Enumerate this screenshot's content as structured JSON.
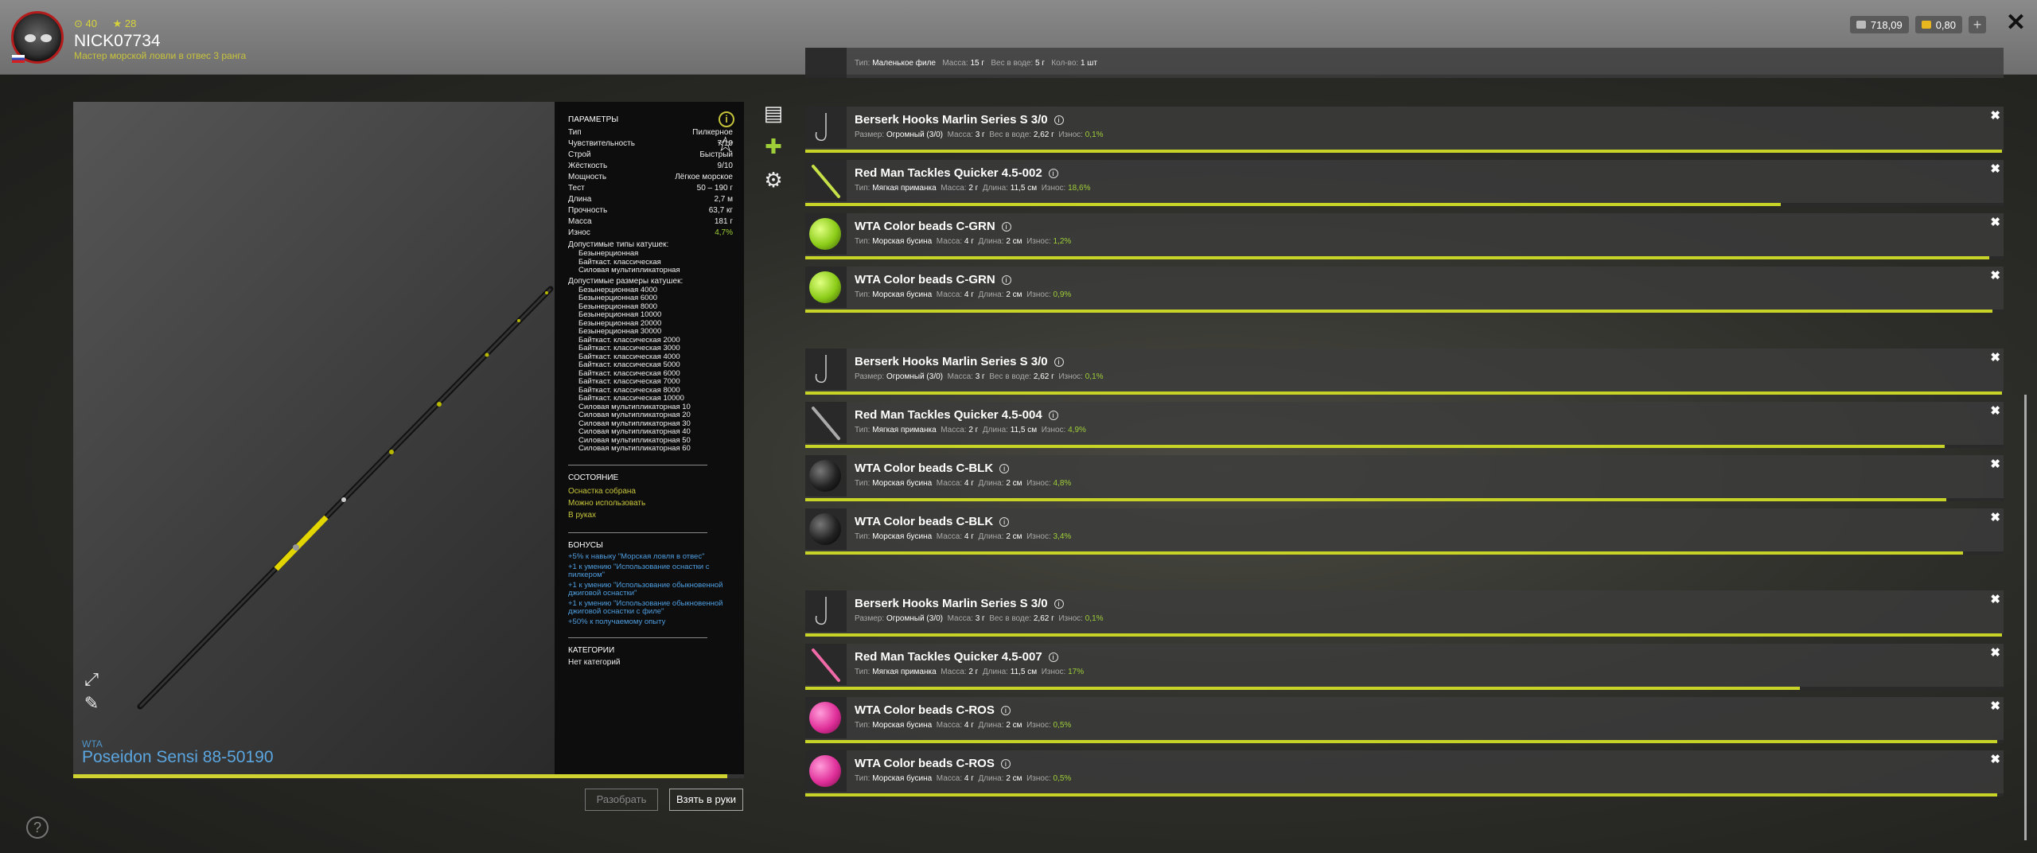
{
  "header": {
    "stats": [
      "40",
      "28"
    ],
    "nickname": "NICK07734",
    "rank": "Мастер морской ловли в отвес 3 ранга",
    "currency_silver": "718,09",
    "currency_gold": "0,80",
    "add_label": "+",
    "close_label": "✕"
  },
  "rod": {
    "brand": "WTA",
    "name": "Poseidon Sensi 88-50190",
    "progress": 0.975
  },
  "params": {
    "title": "ПАРАМЕТРЫ",
    "rows": [
      {
        "k": "Тип",
        "v": "Пилкерное"
      },
      {
        "k": "Чувствительность",
        "v": "7/10"
      },
      {
        "k": "Строй",
        "v": "Быстрый"
      },
      {
        "k": "Жёсткость",
        "v": "9/10"
      },
      {
        "k": "Мощность",
        "v": "Лёгкое морское"
      },
      {
        "k": "Тест",
        "v": "50 – 190 г"
      },
      {
        "k": "Длина",
        "v": "2,7 м"
      },
      {
        "k": "Прочность",
        "v": "63,7 кг"
      },
      {
        "k": "Масса",
        "v": "181 г"
      },
      {
        "k": "Износ",
        "v": "4,7%"
      }
    ],
    "reel_types_title": "Допустимые типы катушек:",
    "reel_types": [
      "Безынерционная",
      "Байткаст. классическая",
      "Силовая мультипликаторная"
    ],
    "reel_sizes_title": "Допустимые размеры катушек:",
    "reel_sizes": [
      "Безынерционная 4000",
      "Безынерционная 6000",
      "Безынерционная 8000",
      "Безынерционная 10000",
      "Безынерционная 20000",
      "Безынерционная 30000",
      "Байткаст. классическая 2000",
      "Байткаст. классическая 3000",
      "Байткаст. классическая 4000",
      "Байткаст. классическая 5000",
      "Байткаст. классическая 6000",
      "Байткаст. классическая 7000",
      "Байткаст. классическая 8000",
      "Байткаст. классическая 10000",
      "Силовая мультипликаторная 10",
      "Силовая мультипликаторная 20",
      "Силовая мультипликаторная 30",
      "Силовая мультипликаторная 40",
      "Силовая мультипликаторная 50",
      "Силовая мультипликаторная 60"
    ],
    "state_title": "СОСТОЯНИЕ",
    "state": [
      "Оснастка собрана",
      "Можно использовать",
      "В руках"
    ],
    "bonus_title": "БОНУСЫ",
    "bonuses": [
      "+5% к навыку \"Морская ловля в отвес\"",
      "+1 к умению \"Использование оснастки с пилкером\"",
      "+1 к умению \"Использование обыкновенной джиговой оснастки\"",
      "+1 к умению \"Использование обыкновенной джиговой оснастки с филе\"",
      "+50% к получаемому опыту"
    ],
    "cat_title": "КАТЕГОРИИ",
    "categories": "Нет категорий"
  },
  "buttons": {
    "disassemble": "Разобрать",
    "take": "Взять в руки"
  },
  "icons": {
    "info": "i",
    "help": "?"
  },
  "top_partial": {
    "type_label": "Тип:",
    "type": "Маленькое филе",
    "mass_label": "Масса:",
    "mass": "15 г",
    "water_label": "Вес в воде:",
    "water": "5 г",
    "count_label": "Кол-во:",
    "count": "1 шт"
  },
  "items": [
    {
      "name": "Berserk Hooks Marlin Series S 3/0",
      "kind": "hook",
      "f1": "Размер:",
      "v1": "Огромный (3/0)",
      "f2": "Масса:",
      "v2": "3 г",
      "f3": "Вес в воде:",
      "v3": "2,62 г",
      "wear_label": "Износ:",
      "wear": "0,1%",
      "bar": 0.999
    },
    {
      "name": "Red Man Tackles Quicker 4.5-002",
      "kind": "lure-green",
      "f1": "Тип:",
      "v1": "Мягкая приманка",
      "f2": "Масса:",
      "v2": "2 г",
      "f3": "Длина:",
      "v3": "11,5 см",
      "wear_label": "Износ:",
      "wear": "18,6%",
      "bar": 0.814
    },
    {
      "name": "WTA Color beads C-GRN",
      "kind": "grn",
      "f1": "Тип:",
      "v1": "Морская бусина",
      "f2": "Масса:",
      "v2": "4 г",
      "f3": "Длина:",
      "v3": "2 см",
      "wear_label": "Износ:",
      "wear": "1,2%",
      "bar": 0.988
    },
    {
      "name": "WTA Color beads C-GRN",
      "kind": "grn",
      "f1": "Тип:",
      "v1": "Морская бусина",
      "f2": "Масса:",
      "v2": "4 г",
      "f3": "Длина:",
      "v3": "2 см",
      "wear_label": "Износ:",
      "wear": "0,9%",
      "bar": 0.991
    },
    {
      "name": "Berserk Hooks Marlin Series S 3/0",
      "kind": "hook",
      "f1": "Размер:",
      "v1": "Огромный (3/0)",
      "f2": "Масса:",
      "v2": "3 г",
      "f3": "Вес в воде:",
      "v3": "2,62 г",
      "wear_label": "Износ:",
      "wear": "0,1%",
      "bar": 0.999
    },
    {
      "name": "Red Man Tackles Quicker 4.5-004",
      "kind": "lure-grey",
      "f1": "Тип:",
      "v1": "Мягкая приманка",
      "f2": "Масса:",
      "v2": "2 г",
      "f3": "Длина:",
      "v3": "11,5 см",
      "wear_label": "Износ:",
      "wear": "4,9%",
      "bar": 0.951
    },
    {
      "name": "WTA Color beads C-BLK",
      "kind": "blk",
      "f1": "Тип:",
      "v1": "Морская бусина",
      "f2": "Масса:",
      "v2": "4 г",
      "f3": "Длина:",
      "v3": "2 см",
      "wear_label": "Износ:",
      "wear": "4,8%",
      "bar": 0.952
    },
    {
      "name": "WTA Color beads C-BLK",
      "kind": "blk",
      "f1": "Тип:",
      "v1": "Морская бусина",
      "f2": "Масса:",
      "v2": "4 г",
      "f3": "Длина:",
      "v3": "2 см",
      "wear_label": "Износ:",
      "wear": "3,4%",
      "bar": 0.966
    },
    {
      "name": "Berserk Hooks Marlin Series S 3/0",
      "kind": "hook",
      "f1": "Размер:",
      "v1": "Огромный (3/0)",
      "f2": "Масса:",
      "v2": "3 г",
      "f3": "Вес в воде:",
      "v3": "2,62 г",
      "wear_label": "Износ:",
      "wear": "0,1%",
      "bar": 0.999
    },
    {
      "name": "Red Man Tackles Quicker 4.5-007",
      "kind": "lure-pink",
      "f1": "Тип:",
      "v1": "Мягкая приманка",
      "f2": "Масса:",
      "v2": "2 г",
      "f3": "Длина:",
      "v3": "11,5 см",
      "wear_label": "Износ:",
      "wear": "17%",
      "bar": 0.83
    },
    {
      "name": "WTA Color beads C-ROS",
      "kind": "ros",
      "f1": "Тип:",
      "v1": "Морская бусина",
      "f2": "Масса:",
      "v2": "4 г",
      "f3": "Длина:",
      "v3": "2 см",
      "wear_label": "Износ:",
      "wear": "0,5%",
      "bar": 0.995
    },
    {
      "name": "WTA Color beads C-ROS",
      "kind": "ros",
      "f1": "Тип:",
      "v1": "Морская бусина",
      "f2": "Масса:",
      "v2": "4 г",
      "f3": "Длина:",
      "v3": "2 см",
      "wear_label": "Износ:",
      "wear": "0,5%",
      "bar": 0.995
    }
  ],
  "close_item_label": "✖"
}
